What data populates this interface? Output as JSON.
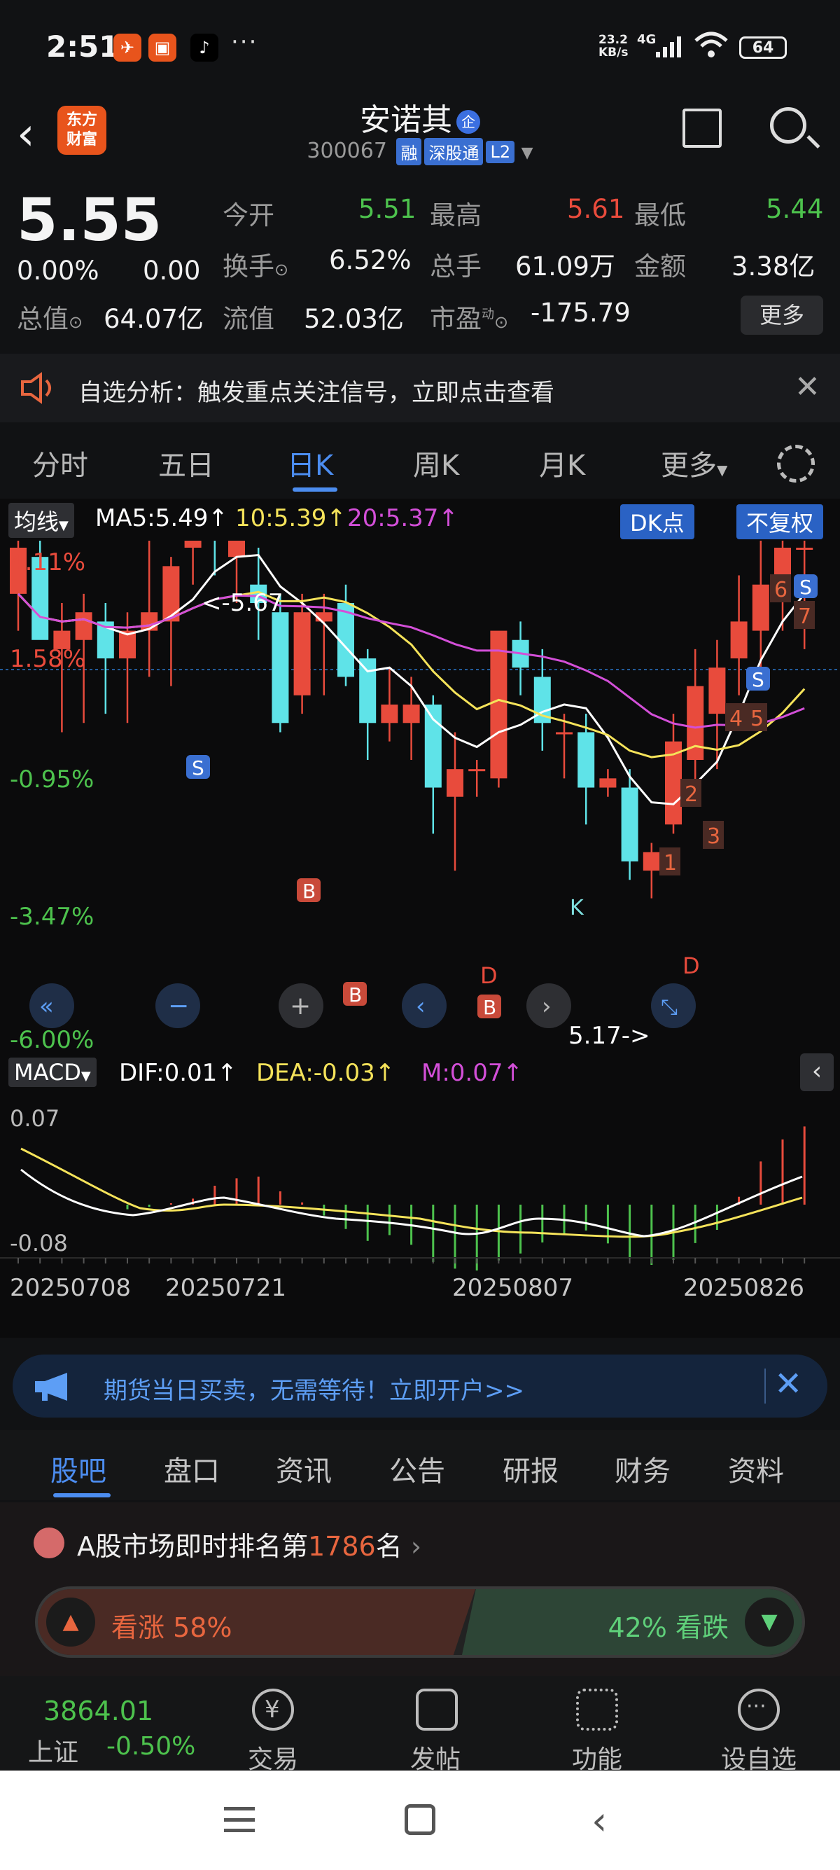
{
  "status_bar": {
    "time": "2:51",
    "dots": "···",
    "net_speed": "23.2\nKB/s",
    "network": "4G",
    "battery": "64"
  },
  "header": {
    "logo_line1": "东方",
    "logo_line2": "财富",
    "stock_name": "安诺其",
    "qy_badge": "企",
    "stock_code": "300067",
    "tag_rong": "融",
    "tag_sgt": "深股通",
    "tag_l2": "L2"
  },
  "quote": {
    "price": "5.55",
    "change_pct": "0.00%",
    "change": "0.00",
    "open_label": "今开",
    "open": "5.51",
    "high_label": "最高",
    "high": "5.61",
    "low_label": "最低",
    "low": "5.44",
    "turnover_label": "换手",
    "turnover": "6.52%",
    "volume_label": "总手",
    "volume": "61.09万",
    "amount_label": "金额",
    "amount": "3.38亿",
    "mcap_label": "总值",
    "mcap": "64.07亿",
    "float_label": "流值",
    "float": "52.03亿",
    "pe_label": "市盈",
    "pe_sup": "动",
    "pe": "-175.79",
    "more_label": "更多"
  },
  "notice": {
    "text": "自选分析：触发重点关注信号，立即点击查看"
  },
  "tabs": [
    "分时",
    "五日",
    "日K",
    "周K",
    "月K",
    "更多"
  ],
  "ma_bar": {
    "btn": "均线",
    "ma5": "MA5:5.49↑",
    "ma10": "10:5.39↑",
    "ma20": "20:5.37↑",
    "dk": "DK点",
    "fq": "不复权"
  },
  "chart_labels": {
    "y_labels": [
      "4.11%",
      "1.58%",
      "-0.95%",
      "-3.47%",
      "-6.00%"
    ],
    "max_annot": "<-5.67",
    "min_annot": "5.17->",
    "macd_btn": "MACD",
    "dif": "DIF:0.01↑",
    "dea": "DEA:-0.03↑",
    "m": "M:0.07↑",
    "macd_top": "0.07",
    "macd_bottom": "-0.08",
    "dates": [
      "20250708",
      "20250721",
      "20250807",
      "20250826"
    ],
    "markers_b": [
      "B",
      "B",
      "B"
    ],
    "markers_s": [
      "S",
      "S",
      "S"
    ],
    "markers_d": [
      "D",
      "D"
    ],
    "marker_k": "K",
    "seq": [
      "1",
      "2",
      "3",
      "4",
      "5",
      "6",
      "7"
    ]
  },
  "chart_data": {
    "type": "candlestick",
    "title": "",
    "ylim_pct": [
      -6.0,
      4.11
    ],
    "y_ticks": [
      "4.11%",
      "1.58%",
      "-0.95%",
      "-3.47%",
      "-6.00%"
    ],
    "x_ticks": [
      "20250708",
      "20250721",
      "20250807",
      "20250826"
    ],
    "max_price": 5.67,
    "min_price": 5.17,
    "candles": [
      {
        "o": 5.55,
        "h": 5.58,
        "l": 5.46,
        "c": 5.5,
        "up": true
      },
      {
        "o": 5.54,
        "h": 5.59,
        "l": 5.48,
        "c": 5.45,
        "up": false
      },
      {
        "o": 5.44,
        "h": 5.49,
        "l": 5.35,
        "c": 5.46,
        "up": true
      },
      {
        "o": 5.45,
        "h": 5.5,
        "l": 5.36,
        "c": 5.48,
        "up": true
      },
      {
        "o": 5.47,
        "h": 5.49,
        "l": 5.37,
        "c": 5.43,
        "up": false
      },
      {
        "o": 5.43,
        "h": 5.48,
        "l": 5.36,
        "c": 5.46,
        "up": true
      },
      {
        "o": 5.46,
        "h": 5.56,
        "l": 5.41,
        "c": 5.48,
        "up": true
      },
      {
        "o": 5.47,
        "h": 5.54,
        "l": 5.4,
        "c": 5.53,
        "up": true
      },
      {
        "o": 5.55,
        "h": 5.57,
        "l": 5.51,
        "c": 5.57,
        "up": true
      },
      {
        "o": 5.59,
        "h": 5.67,
        "l": 5.52,
        "c": 5.58,
        "up": false
      },
      {
        "o": 5.56,
        "h": 5.58,
        "l": 5.49,
        "c": 5.54,
        "up": true
      },
      {
        "o": 5.51,
        "h": 5.55,
        "l": 5.45,
        "c": 5.49,
        "up": false
      },
      {
        "o": 5.48,
        "h": 5.5,
        "l": 5.35,
        "c": 5.36,
        "up": false
      },
      {
        "o": 5.39,
        "h": 5.5,
        "l": 5.37,
        "c": 5.48,
        "up": true
      },
      {
        "o": 5.48,
        "h": 5.5,
        "l": 5.39,
        "c": 5.47,
        "up": true
      },
      {
        "o": 5.49,
        "h": 5.51,
        "l": 5.4,
        "c": 5.41,
        "up": false
      },
      {
        "o": 5.43,
        "h": 5.44,
        "l": 5.32,
        "c": 5.36,
        "up": false
      },
      {
        "o": 5.36,
        "h": 5.42,
        "l": 5.34,
        "c": 5.38,
        "up": true
      },
      {
        "o": 5.36,
        "h": 5.41,
        "l": 5.32,
        "c": 5.38,
        "up": true
      },
      {
        "o": 5.38,
        "h": 5.39,
        "l": 5.24,
        "c": 5.29,
        "up": false
      },
      {
        "o": 5.28,
        "h": 5.35,
        "l": 5.2,
        "c": 5.31,
        "up": true
      },
      {
        "o": 5.31,
        "h": 5.32,
        "l": 5.28,
        "c": 5.31,
        "up": true
      },
      {
        "o": 5.3,
        "h": 5.43,
        "l": 5.29,
        "c": 5.46,
        "up": true
      },
      {
        "o": 5.45,
        "h": 5.47,
        "l": 5.39,
        "c": 5.42,
        "up": false
      },
      {
        "o": 5.41,
        "h": 5.44,
        "l": 5.33,
        "c": 5.36,
        "up": false
      },
      {
        "o": 5.35,
        "h": 5.37,
        "l": 5.3,
        "c": 5.35,
        "up": true
      },
      {
        "o": 5.35,
        "h": 5.37,
        "l": 5.25,
        "c": 5.29,
        "up": false
      },
      {
        "o": 5.29,
        "h": 5.31,
        "l": 5.28,
        "c": 5.3,
        "up": true
      },
      {
        "o": 5.29,
        "h": 5.31,
        "l": 5.19,
        "c": 5.21,
        "up": false
      },
      {
        "o": 5.2,
        "h": 5.23,
        "l": 5.17,
        "c": 5.22,
        "up": true
      },
      {
        "o": 5.25,
        "h": 5.37,
        "l": 5.24,
        "c": 5.34,
        "up": true
      },
      {
        "o": 5.32,
        "h": 5.44,
        "l": 5.28,
        "c": 5.4,
        "up": true
      },
      {
        "o": 5.37,
        "h": 5.45,
        "l": 5.31,
        "c": 5.42,
        "up": true
      },
      {
        "o": 5.43,
        "h": 5.52,
        "l": 5.39,
        "c": 5.47,
        "up": true
      },
      {
        "o": 5.46,
        "h": 5.56,
        "l": 5.42,
        "c": 5.51,
        "up": true
      },
      {
        "o": 5.5,
        "h": 5.61,
        "l": 5.46,
        "c": 5.55,
        "up": true
      },
      {
        "o": 5.55,
        "h": 5.63,
        "l": 5.44,
        "c": 5.55,
        "up": true
      }
    ],
    "macd": {
      "dif": 0.01,
      "dea": -0.03,
      "m": 0.07,
      "ylim": [
        -0.08,
        0.07
      ]
    }
  },
  "ad": {
    "text": "期货当日买卖，无需等待！立即开户>>"
  },
  "bottom_tabs": [
    "股吧",
    "盘口",
    "资讯",
    "公告",
    "研报",
    "财务",
    "资料"
  ],
  "rank": {
    "prefix": "A股市场即时排名第",
    "num": "1786",
    "suffix": "名",
    "up_label": "看涨 58%",
    "down_label": "42% 看跌",
    "up_fraction": 0.58
  },
  "bottom_nav": {
    "index_value": "3864.01",
    "index_name": "上证",
    "index_change": "-0.50%",
    "trade": "交易",
    "post": "发帖",
    "func": "功能",
    "watch": "设自选"
  }
}
